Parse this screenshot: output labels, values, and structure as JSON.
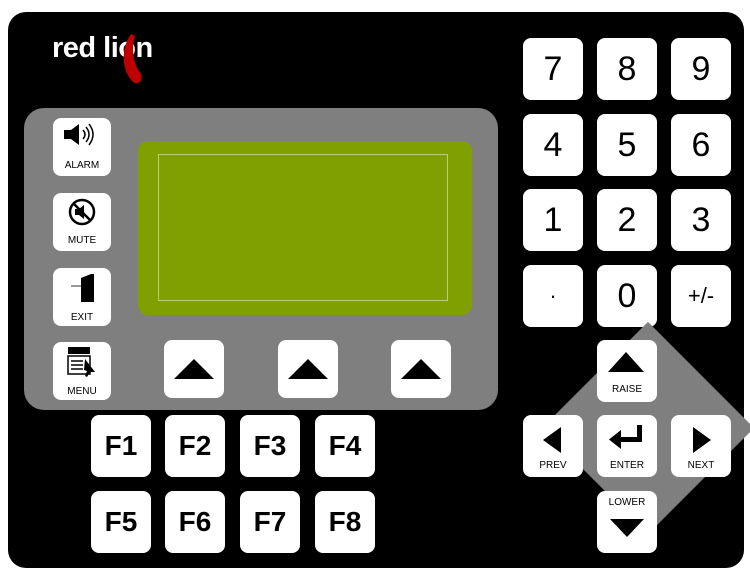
{
  "brand": {
    "logo_text": "red lion",
    "accent_color": "#c00000"
  },
  "display": {
    "screen_color": "#7fa000"
  },
  "side_keys": [
    {
      "label": "ALARM",
      "icon": "speaker-icon"
    },
    {
      "label": "MUTE",
      "icon": "mute-icon"
    },
    {
      "label": "EXIT",
      "icon": "door-exit-icon"
    },
    {
      "label": "MENU",
      "icon": "menu-icon"
    }
  ],
  "soft_keys": [
    {
      "icon": "arrow-up-icon"
    },
    {
      "icon": "arrow-up-icon"
    },
    {
      "icon": "arrow-up-icon"
    }
  ],
  "function_keys": [
    "F1",
    "F2",
    "F3",
    "F4",
    "F5",
    "F6",
    "F7",
    "F8"
  ],
  "keypad": [
    "7",
    "8",
    "9",
    "4",
    "5",
    "6",
    "1",
    "2",
    "3",
    "·",
    "0",
    "+/-"
  ],
  "nav": {
    "raise": "RAISE",
    "lower": "LOWER",
    "prev": "PREV",
    "next": "NEXT",
    "enter": "ENTER"
  }
}
